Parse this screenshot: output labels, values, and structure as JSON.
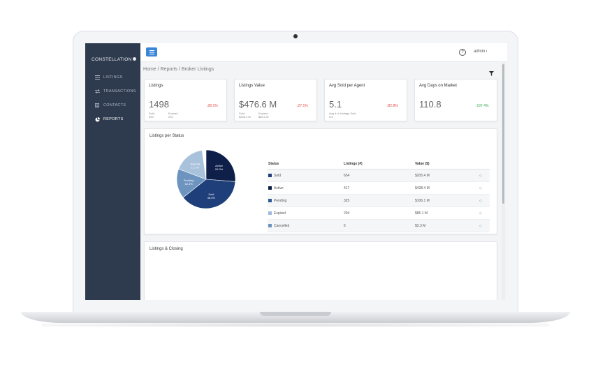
{
  "brand": "CONSTELLATION",
  "sidebar": {
    "items": [
      {
        "label": "LISTINGS",
        "icon": "list-icon",
        "active": false
      },
      {
        "label": "TRANSACTIONS",
        "icon": "exchange-icon",
        "active": false
      },
      {
        "label": "CONTACTS",
        "icon": "contact-card-icon",
        "active": false
      },
      {
        "label": "REPORTS",
        "icon": "pie-chart-icon",
        "active": true
      }
    ]
  },
  "topbar": {
    "help_label": "?",
    "user": "admin"
  },
  "breadcrumb": "Home / Reports / Broker Listings",
  "kpis": [
    {
      "title": "Listings",
      "value": "1498",
      "change": "28.1%",
      "direction": "down",
      "sub": [
        {
          "label": "Sold",
          "value": "654"
        },
        {
          "label": "Expired",
          "value": "294"
        }
      ]
    },
    {
      "title": "Listings Value",
      "value": "$476.6 M",
      "change": "27.1%",
      "direction": "down",
      "sub": [
        {
          "label": "Sold",
          "value": "$205.4 M"
        },
        {
          "label": "Expired",
          "value": "$83.1 M"
        }
      ]
    },
    {
      "title": "Avg Sold per Agent",
      "value": "5.1",
      "change": "82.8%",
      "direction": "down",
      "sub": [
        {
          "label": "Avg # of Listings Sold",
          "value": "5.5"
        }
      ]
    },
    {
      "title": "Avg Days on Market",
      "value": "110.8",
      "change": "197.4%",
      "direction": "up",
      "sub": []
    }
  ],
  "status_section": {
    "title": "Listings per Status",
    "columns": [
      "Status",
      "Listings (#)",
      "Value ($)"
    ],
    "rows": [
      {
        "status": "Sold",
        "listings": "654",
        "value": "$205.4 M",
        "color": "#1f3f7a"
      },
      {
        "status": "Active",
        "listings": "417",
        "value": "$438.4 M",
        "color": "#0e1f4a"
      },
      {
        "status": "Pending",
        "listings": "325",
        "value": "$106.1 M",
        "color": "#2f5a96"
      },
      {
        "status": "Expired",
        "listings": "294",
        "value": "$85.1 M",
        "color": "#9fbbd8"
      },
      {
        "status": "Cancelled",
        "listings": "5",
        "value": "$3.3 M",
        "color": "#6d93bf"
      }
    ],
    "pie": {
      "slices": [
        {
          "label": "Active",
          "percent": "26.3%",
          "share": 0.263,
          "color": "#0e1f4a"
        },
        {
          "label": "Sold",
          "percent": "38.0%",
          "share": 0.38,
          "color": "#1f3f7a"
        },
        {
          "label": "Pending",
          "percent": "16.4%",
          "share": 0.164,
          "color": "#6d93bf"
        },
        {
          "label": "Expired",
          "percent": "17.1%",
          "share": 0.171,
          "color": "#a9c2dc"
        }
      ]
    }
  },
  "closing_section": {
    "title": "Listings & Closing"
  },
  "colors": {
    "sidebar": "#2e3b4e",
    "accent": "#3b86d8",
    "down": "#e0473f",
    "up": "#3aa552"
  }
}
